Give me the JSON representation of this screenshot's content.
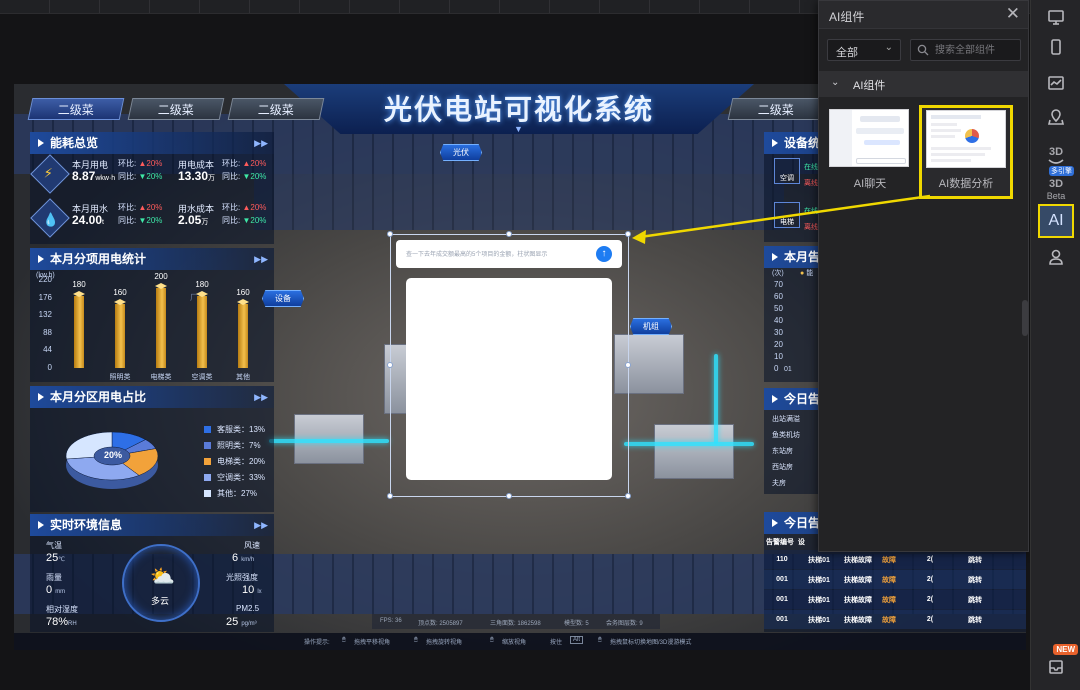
{
  "dashboard": {
    "title": "光伏电站可视化系统",
    "nav_tabs": [
      "二级菜",
      "二级菜",
      "二级菜",
      "二级菜"
    ],
    "energy": {
      "title": "能耗总览",
      "power_label": "本月用电",
      "power_value": "8.87",
      "power_unit": "wkw·h",
      "cost1_label": "用电成本",
      "cost1_value": "13.30",
      "cost1_unit": "万",
      "water_label": "本月用水",
      "water_value": "24.00",
      "water_unit": "t",
      "cost2_label": "用水成本",
      "cost2_value": "2.05",
      "cost2_unit": "万",
      "ratio_hb": "环比:",
      "ratio_tb": "同比:",
      "ratio_up": "20%",
      "ratio_down": "20%"
    },
    "power_stats": {
      "title": "本月分项用电统计",
      "unit": "(kw.h)",
      "watermark": "厂房"
    },
    "area_share": {
      "title": "本月分区用电占比",
      "center_label": "20%"
    },
    "env": {
      "title": "实时环境信息",
      "temp_label": "气温",
      "temp_value": "25",
      "temp_unit": "℃",
      "rain_label": "雨量",
      "rain_value": "0",
      "rain_unit": "mm",
      "humidity_label": "相对湿度",
      "humidity_value": "78%",
      "humidity_unit": "RH",
      "wind_label": "风速",
      "wind_value": "6",
      "wind_unit": "km/h",
      "light_label": "光照强度",
      "light_value": "10",
      "light_unit": "lx",
      "pm_label": "PM2.5",
      "pm_value": "25",
      "pm_unit": "pg/m³",
      "weather": "多云"
    },
    "right": {
      "equip_title": "设备统",
      "equip_items": [
        "空调",
        "电梯"
      ],
      "equip_states": [
        "在线",
        "离线"
      ],
      "alarm_title": "本月告",
      "alarm_unit": "(次)",
      "alarm_ticks": [
        "70",
        "60",
        "50",
        "40",
        "30",
        "20",
        "10",
        "0"
      ],
      "alarm_legend": "能",
      "alarm_x": "01",
      "today_title": "今日告",
      "today_rows": [
        "出站满溢",
        "鱼类机坊",
        "东站房",
        "西站房",
        "夫房"
      ],
      "table_title": "今日告",
      "table_head": [
        "告警编号",
        "设"
      ],
      "table_rows": [
        [
          "110",
          "扶梯01",
          "扶梯故障",
          "故障",
          "2(",
          "跳转"
        ],
        [
          "001",
          "扶梯01",
          "扶梯故障",
          "故障",
          "2(",
          "跳转"
        ],
        [
          "001",
          "扶梯01",
          "扶梯故障",
          "故障",
          "2(",
          "跳转"
        ],
        [
          "001",
          "扶梯01",
          "扶梯故障",
          "故障",
          "2(",
          "跳转"
        ]
      ]
    },
    "map_tags": {
      "pv": "光伏",
      "equipment": "设备",
      "unit": "机组"
    },
    "ai_chat": {
      "placeholder": "查一下去年成交额最高的5个项目的金额，柱状图显示",
      "send": "↑"
    },
    "info_bar": [
      "FPS: 36",
      "顶点数: 2505897",
      "三角面数: 1862598",
      "模型数: 5",
      "会务图层数: 9"
    ],
    "status_bar": {
      "hint": "操作提示:",
      "pan": "拖拽平移视角",
      "rotate": "拖拽旋转视角",
      "zoom": "缩放视角",
      "then": "按住",
      "key": "Alt",
      "switch": "拖拽鼠标切换地图/3D漫游模式"
    }
  },
  "chart_data": [
    {
      "type": "bar",
      "title": "本月分项用电统计",
      "ylabel": "(kw.h)",
      "categories": [
        " ",
        "照明类",
        "电梯类",
        "空调类",
        "其他"
      ],
      "values": [
        180,
        160,
        200,
        180,
        160
      ],
      "yticks": [
        0,
        44,
        88,
        132,
        176,
        220
      ],
      "ylim": [
        0,
        220
      ]
    },
    {
      "type": "pie",
      "title": "本月分区用电占比",
      "categories": [
        "客服类",
        "照明类",
        "电梯类",
        "空调类",
        "其他"
      ],
      "values": [
        13,
        7,
        20,
        33,
        27
      ],
      "colors": [
        "#2e6fe6",
        "#5a7bd8",
        "#f2a23a",
        "#8ea9f0",
        "#d6e6ff"
      ],
      "legend_text": [
        "客服类：13%",
        "照明类：7%",
        "电梯类：20%",
        "空调类：33%",
        "其他：27%"
      ]
    }
  ],
  "ai_panel": {
    "title": "AI组件",
    "filter": "全部",
    "search_placeholder": "搜索全部组件",
    "category": "AI组件",
    "components": [
      "AI聊天",
      "AI数据分析"
    ]
  },
  "rail": {
    "beta": "Beta",
    "ai": "AI",
    "new": "NEW",
    "multi": "多引擎",
    "three_d": "3D"
  }
}
